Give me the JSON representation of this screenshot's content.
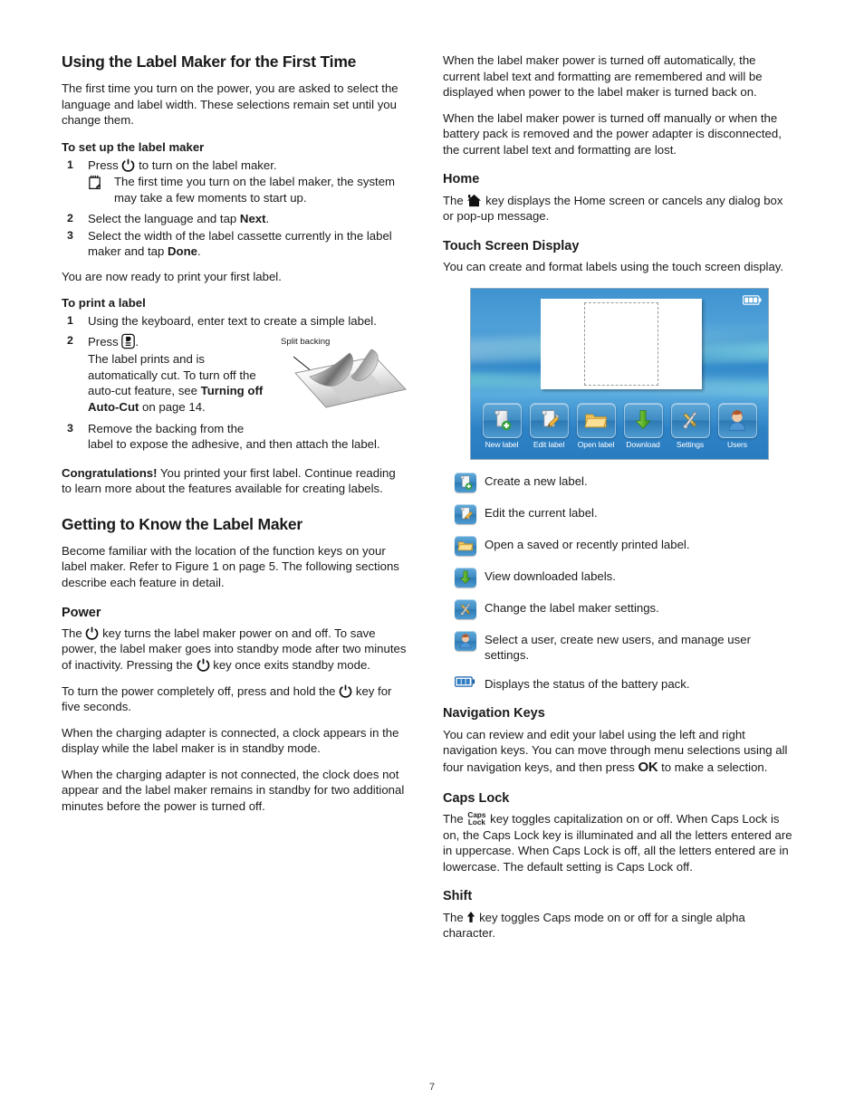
{
  "page_number": "7",
  "left_column": {
    "heading": "Using the Label Maker for the First Time",
    "intro": "The first time you turn on the power, you are asked to select the language and label width. These selections remain set until you change them.",
    "setup_heading": "To set up the label maker",
    "setup_steps": [
      {
        "num": "1",
        "before": "Press",
        "icon": "power-icon",
        "after": "to turn on the label maker."
      },
      {
        "num": "2",
        "before": "Select the language and tap",
        "bold": "Next",
        "after": "."
      },
      {
        "num": "3",
        "before": "Select the width of the label cassette currently in the label maker and tap",
        "bold": "Done",
        "after": "."
      }
    ],
    "setup_note": "The first time you turn on the label maker, the system may take a few moments to start up.",
    "ready_text": "You are now ready to print your first label.",
    "print_heading": "To print a label",
    "print_steps": [
      {
        "num": "1",
        "text": "Using the keyboard, enter text to create a simple label."
      },
      {
        "num": "2",
        "before": "Press",
        "icon": "print-icon",
        "after": "."
      },
      {
        "num": "3",
        "text": "Remove the backing from the label to expose the adhesive, and then attach the label."
      }
    ],
    "print_result_pre": "The label prints and is automatically cut. To turn off the auto-cut feature, see ",
    "print_result_bold": "Turning off Auto-Cut",
    "print_result_post": " on page 14.",
    "figure_caption": "Split backing",
    "congrats_bold": "Congratulations!",
    "congrats_text": " You printed your first label. Continue reading to learn more about the features available for creating labels.",
    "getting_to_know_heading": "Getting to Know the Label Maker",
    "getting_to_know_text": "Become familiar with the location of the function keys on your label maker. Refer to Figure 1 on page 5. The following sections describe each feature in detail.",
    "power_heading": "Power",
    "power_p1_a": "The",
    "power_p1_b": "key turns the label maker power on and off. To save power, the label maker goes into standby mode after two minutes of inactivity. Pressing the",
    "power_p1_c": "key once exits standby mode.",
    "power_p2_a": "To turn the power completely off, press and hold the",
    "power_p2_b": "key for five seconds.",
    "power_p3": "When the charging adapter is connected, a clock appears in the display while the label maker is in standby mode.",
    "power_p4": "When the charging adapter is not connected, the clock does not appear and the label maker remains in standby for two additional minutes before the power is turned off."
  },
  "right_column": {
    "p1": "When the label maker power is turned off automatically, the current label text and formatting are remembered and will be displayed when power to the label maker is turned back on.",
    "p2": "When the label maker power is turned off manually or when the battery pack is removed and the power adapter is disconnected, the current label text and formatting are lost.",
    "home_heading": "Home",
    "home_a": "The",
    "home_b": "key displays the Home screen or cancels any dialog box or pop-up message.",
    "touch_heading": "Touch Screen Display",
    "touch_text": "You can create and format labels using the touch screen display.",
    "device_screen": {
      "battery_icon": "battery-icon",
      "dock_items": [
        {
          "label": "New label",
          "icon": "new-label-icon"
        },
        {
          "label": "Edit label",
          "icon": "edit-label-icon"
        },
        {
          "label": "Open label",
          "icon": "open-label-icon"
        },
        {
          "label": "Download",
          "icon": "download-icon"
        },
        {
          "label": "Settings",
          "icon": "settings-icon"
        },
        {
          "label": "Users",
          "icon": "users-icon"
        }
      ]
    },
    "legend": [
      {
        "icon": "new-label-icon",
        "text": "Create a new label."
      },
      {
        "icon": "edit-label-icon",
        "text": "Edit the current label."
      },
      {
        "icon": "open-label-icon",
        "text": "Open a saved or recently printed label."
      },
      {
        "icon": "download-icon",
        "text": "View downloaded labels."
      },
      {
        "icon": "settings-icon",
        "text": "Change the label maker settings."
      },
      {
        "icon": "users-icon",
        "text": "Select a user, create new users, and manage user settings."
      },
      {
        "icon": "battery-icon",
        "text": "Displays the status of the battery pack."
      }
    ],
    "nav_heading": "Navigation Keys",
    "nav_a": "You can review and edit your label using the left and right navigation keys. You can move through menu selections using all four navigation keys, and then press",
    "nav_ok": "OK",
    "nav_b": "to make a selection.",
    "caps_heading": "Caps Lock",
    "caps_a": "The",
    "caps_key_line1": "Caps",
    "caps_key_line2": "Lock",
    "caps_b": "key toggles capitalization on or off. When Caps Lock is on, the Caps Lock key is illuminated and all the letters entered are in uppercase. When Caps Lock is off, all the letters entered are in lowercase. The default setting is Caps Lock off.",
    "shift_heading": "Shift",
    "shift_a": "The",
    "shift_b": "key toggles Caps mode on or off for a single alpha character."
  },
  "colors": {
    "screen_blue": "#3f93d0",
    "tile_blue": "#3f8cc4",
    "folder_yellow": "#f0c35a",
    "download_green": "#6fbf3a",
    "plus_green": "#34a43a",
    "text": "#1a1a1a"
  }
}
